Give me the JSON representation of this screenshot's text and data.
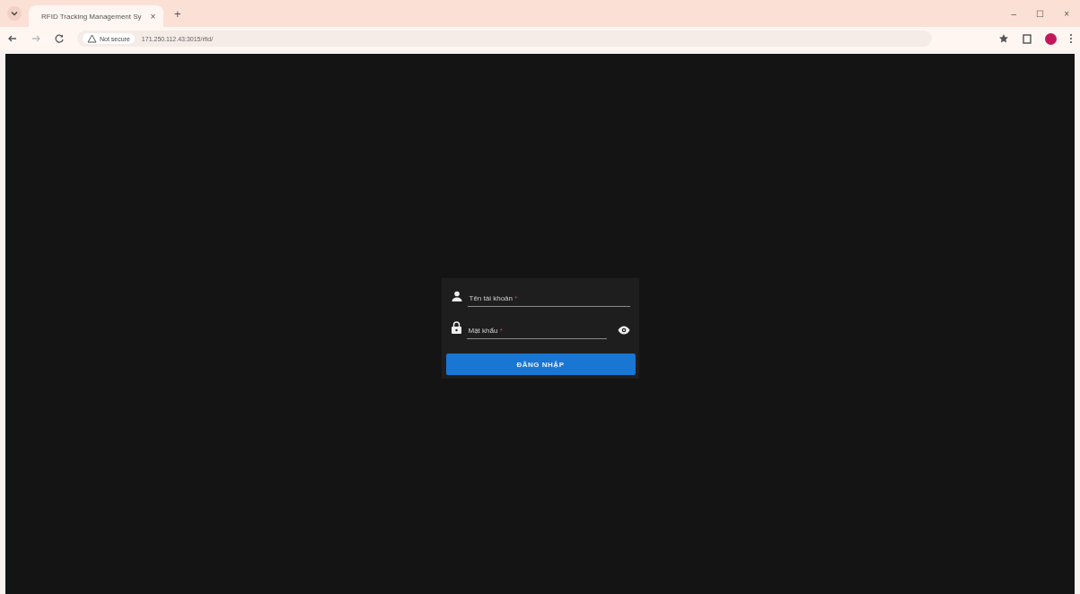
{
  "browser": {
    "tab": {
      "title": "RFID Tracking Management Sy",
      "close": "×"
    },
    "new_tab": "+",
    "security": "Not secure",
    "url": "171.250.112.43:3015/rfid/",
    "window_controls": [
      "–",
      "☐",
      "×"
    ]
  },
  "login": {
    "fields": [
      {
        "kind": "text",
        "label": "Tên tài khoản",
        "required_mark": "*"
      },
      {
        "kind": "password",
        "label": "Mật khẩu",
        "required_mark": "*"
      }
    ],
    "submit": "ĐĂNG NHẬP"
  }
}
